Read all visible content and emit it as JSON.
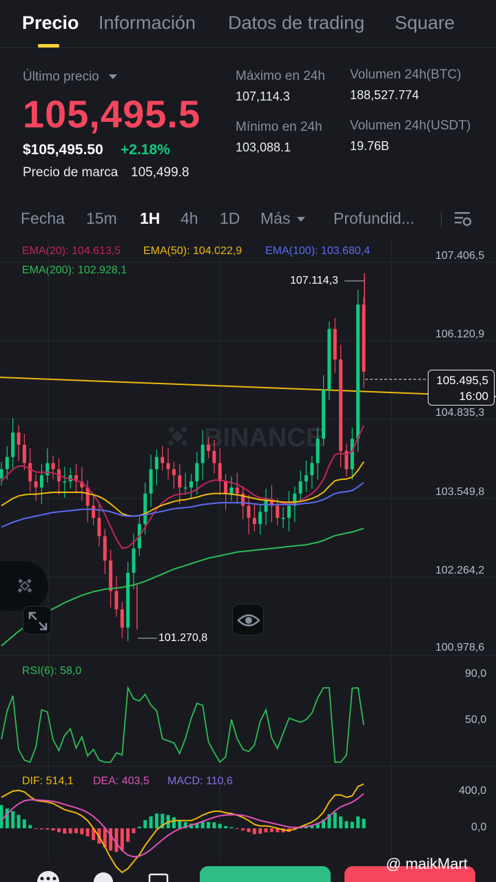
{
  "tabs": [
    {
      "label": "Precio",
      "active": true
    },
    {
      "label": "Información"
    },
    {
      "label": "Datos de trading"
    },
    {
      "label": "Square"
    }
  ],
  "ticker": {
    "last_label": "Último precio",
    "last_price": "105,495.5",
    "usd_price": "$105,495.50",
    "change": "+2.18%",
    "mark_label": "Precio de marca",
    "mark_price": "105,499.8",
    "high_label": "Máximo en 24h",
    "high": "107,114.3",
    "low_label": "Mínimo en 24h",
    "low": "103,088.1",
    "vol_btc_label": "Volumen 24h(BTC)",
    "vol_btc": "188,527.774",
    "vol_usdt_label": "Volumen 24h(USDT)",
    "vol_usdt": "19.76B"
  },
  "intervals": [
    "Fecha",
    "15m",
    "1H",
    "4h",
    "1D",
    "Más",
    "Profundid..."
  ],
  "active_interval": "1H",
  "ema": {
    "ema20": "EMA(20): 104.613,5",
    "ema50": "EMA(50): 104.022,9",
    "ema100": "EMA(100): 103.680,4",
    "ema200": "EMA(200): 102.928,1"
  },
  "axis": {
    "p1": "107.406,5",
    "p2": "106.120,9",
    "p3": "104.835,3",
    "p4": "103.549,8",
    "p5": "102.264,2",
    "p6": "100.978,6",
    "rsi_high": "90,0",
    "rsi_mid": "50,0",
    "macd_high": "400,0",
    "macd_zero": "0,0"
  },
  "annotations": {
    "high": "107.114,3",
    "low": "101.270,8",
    "current_price": "105.495,5",
    "countdown": "16:00"
  },
  "watermark_brand": "BINANCE",
  "rsi_label": "RSI(6): 58,0",
  "macd": {
    "dif": "DIF: 514,1",
    "dea": "DEA: 403,5",
    "macd": "MACD: 110,6"
  },
  "footer_watermark": "@ maikMart",
  "colors": {
    "up": "#0ecb81",
    "down": "#f6465d",
    "accent": "#fcd535",
    "ema20": "#c2255c",
    "ema50": "#f0b90b",
    "ema100": "#5b6cf0",
    "ema200": "#2ebd55",
    "rsi": "#2ebd55",
    "dea": "#e052b5",
    "macd_label": "#8a6fe0",
    "trendline": "#f0b90b"
  },
  "chart_data": {
    "type": "candlestick",
    "symbol_interval": "1H",
    "ylim": [
      100978.6,
      107406.5
    ],
    "high": 107114.3,
    "low": 101270.8,
    "last": 105495.5,
    "close_series": [
      103900,
      104100,
      104500,
      104300,
      104000,
      103700,
      103600,
      103800,
      104000,
      103900,
      103700,
      103700,
      103800,
      103700,
      103600,
      103300,
      103100,
      102800,
      102400,
      101900,
      101600,
      101300,
      102200,
      102600,
      103000,
      103500,
      103900,
      104100,
      104000,
      103900,
      103800,
      103600,
      103600,
      103700,
      104000,
      104300,
      104200,
      104000,
      103700,
      103500,
      103600,
      103500,
      103300,
      103100,
      103000,
      103200,
      103400,
      103300,
      103100,
      103100,
      103300,
      103500,
      103700,
      103800,
      104000,
      104400,
      105200,
      106200,
      105700,
      104200,
      103900,
      104400,
      106600,
      105500
    ],
    "ema_series": [
      {
        "name": "EMA(20)",
        "values": [
          103700,
          103800,
          103900,
          103950,
          103950,
          103900,
          103850,
          103850,
          103850,
          103840,
          103800,
          103760,
          103740,
          103720,
          103680,
          103600,
          103480,
          103340,
          103160,
          102950,
          102750,
          102600,
          102620,
          102700,
          102800,
          102950,
          103100,
          103250,
          103350,
          103420,
          103470,
          103490,
          103500,
          103520,
          103570,
          103640,
          103690,
          103720,
          103720,
          103700,
          103680,
          103650,
          103600,
          103540,
          103470,
          103430,
          103420,
          103400,
          103370,
          103340,
          103330,
          103350,
          103390,
          103440,
          103500,
          103590,
          103730,
          103960,
          104140,
          104160,
          104140,
          104190,
          104420,
          104613.5
        ]
      },
      {
        "name": "EMA(50)",
        "values": [
          103300,
          103360,
          103420,
          103460,
          103480,
          103490,
          103490,
          103500,
          103510,
          103520,
          103520,
          103520,
          103520,
          103520,
          103520,
          103500,
          103480,
          103450,
          103400,
          103330,
          103250,
          103170,
          103140,
          103130,
          103140,
          103170,
          103220,
          103270,
          103310,
          103340,
          103370,
          103390,
          103400,
          103420,
          103440,
          103470,
          103490,
          103500,
          103500,
          103500,
          103490,
          103480,
          103460,
          103440,
          103420,
          103400,
          103390,
          103380,
          103370,
          103360,
          103360,
          103360,
          103370,
          103390,
          103420,
          103460,
          103520,
          103620,
          103710,
          103730,
          103740,
          103770,
          103880,
          104022.9
        ]
      },
      {
        "name": "EMA(100)",
        "values": [
          102950,
          102990,
          103030,
          103060,
          103090,
          103110,
          103130,
          103150,
          103170,
          103190,
          103200,
          103210,
          103220,
          103230,
          103240,
          103240,
          103240,
          103230,
          103220,
          103200,
          103170,
          103140,
          103130,
          103130,
          103140,
          103150,
          103170,
          103190,
          103210,
          103230,
          103250,
          103260,
          103270,
          103280,
          103300,
          103320,
          103330,
          103340,
          103350,
          103350,
          103350,
          103350,
          103350,
          103340,
          103330,
          103320,
          103320,
          103320,
          103320,
          103320,
          103320,
          103320,
          103330,
          103340,
          103350,
          103370,
          103400,
          103450,
          103500,
          103520,
          103530,
          103550,
          103610,
          103680.4
        ]
      },
      {
        "name": "EMA(200)",
        "values": [
          101000,
          101080,
          101160,
          101240,
          101310,
          101380,
          101440,
          101500,
          101560,
          101610,
          101660,
          101710,
          101750,
          101790,
          101830,
          101860,
          101890,
          101910,
          101930,
          101940,
          101950,
          101960,
          101980,
          102000,
          102030,
          102060,
          102100,
          102140,
          102180,
          102220,
          102260,
          102290,
          102320,
          102350,
          102380,
          102410,
          102440,
          102460,
          102480,
          102500,
          102520,
          102540,
          102550,
          102560,
          102570,
          102580,
          102590,
          102600,
          102610,
          102620,
          102630,
          102640,
          102650,
          102660,
          102680,
          102700,
          102730,
          102770,
          102810,
          102830,
          102850,
          102870,
          102900,
          102928.1
        ]
      }
    ],
    "rsi": {
      "label": "RSI(6)",
      "current": 58.0,
      "ylim": [
        20,
        100
      ]
    },
    "macd": {
      "dif": 514.1,
      "dea": 403.5,
      "macd": 110.6
    }
  }
}
